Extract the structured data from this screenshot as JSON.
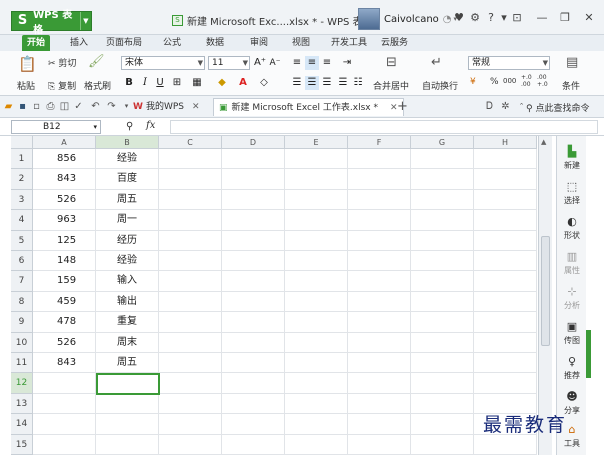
{
  "title_bar": {
    "app_button": "WPS 表格",
    "app_logo": "S",
    "doc_title": "新建 Microsoft Exc....xlsx * - WPS 表格",
    "user_name": "Caivolcano"
  },
  "menu_tabs": [
    "开始",
    "插入",
    "页面布局",
    "公式",
    "数据",
    "审阅",
    "视图",
    "开发工具",
    "云服务"
  ],
  "ribbon": {
    "cut": "剪切",
    "copy": "复制",
    "paste": "粘贴",
    "format_painter": "格式刷",
    "font_name": "宋体",
    "font_size": "11",
    "bold": "B",
    "italic": "I",
    "underline": "U",
    "merge_center": "合并居中",
    "wrap_text": "自动换行",
    "number_format": "常规",
    "percent": "%",
    "thousands": "000",
    "inc_decimal": "+.0 .00",
    "dec_decimal": ".00 +.0",
    "conditional": "条件"
  },
  "quick_access": {
    "tab_my_wps": "我的WPS",
    "tab_doc": "新建 Microsoft Excel 工作表.xlsx *",
    "add_tab": "+",
    "search_cmd": "点此查找命令"
  },
  "formula_bar": {
    "name_box": "B12",
    "fx": "fx"
  },
  "sheet": {
    "columns": [
      "A",
      "B",
      "C",
      "D",
      "E",
      "F",
      "G",
      "H"
    ],
    "rows": [
      {
        "n": "1",
        "a": "856",
        "b": "经验"
      },
      {
        "n": "2",
        "a": "843",
        "b": "百度"
      },
      {
        "n": "3",
        "a": "526",
        "b": "周五"
      },
      {
        "n": "4",
        "a": "963",
        "b": "周一"
      },
      {
        "n": "5",
        "a": "125",
        "b": "经历"
      },
      {
        "n": "6",
        "a": "148",
        "b": "经验"
      },
      {
        "n": "7",
        "a": "159",
        "b": "输入"
      },
      {
        "n": "8",
        "a": "459",
        "b": "输出"
      },
      {
        "n": "9",
        "a": "478",
        "b": "重复"
      },
      {
        "n": "10",
        "a": "526",
        "b": "周末"
      },
      {
        "n": "11",
        "a": "843",
        "b": "周五"
      },
      {
        "n": "12",
        "a": "",
        "b": ""
      },
      {
        "n": "13",
        "a": "",
        "b": ""
      },
      {
        "n": "14",
        "a": "",
        "b": ""
      },
      {
        "n": "15",
        "a": "",
        "b": ""
      }
    ]
  },
  "side_panel": [
    "新建",
    "选择",
    "形状",
    "属性",
    "分析",
    "传图",
    "推荐",
    "分享",
    "工具"
  ],
  "watermark": "最需教育",
  "colors": {
    "accent": "#3a9a36",
    "watermark": "#1a2c7a"
  }
}
